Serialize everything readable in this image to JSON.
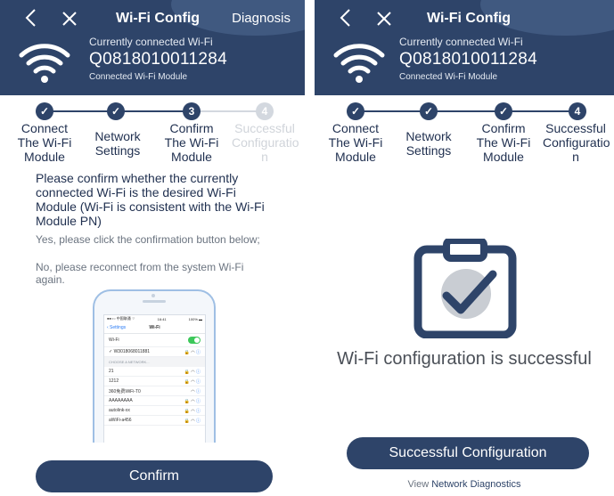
{
  "left": {
    "title": "Wi-Fi Config",
    "diagnosis": "Diagnosis",
    "current_label": "Currently connected Wi-Fi",
    "ssid": "Q0818010011284",
    "module_label": "Connected Wi-Fi Module",
    "steps": [
      {
        "num": "✓",
        "label": "Connect The Wi-Fi Module",
        "state": "done"
      },
      {
        "num": "✓",
        "label": "Network Settings",
        "state": "done"
      },
      {
        "num": "3",
        "label": "Confirm The Wi-Fi Module",
        "state": "current"
      },
      {
        "num": "4",
        "label": "Successful Configuratio n",
        "state": "pending"
      }
    ],
    "message": "Please confirm whether the currently connected Wi-Fi is the desired Wi-Fi Module (Wi-Fi is consistent with the Wi-Fi Module PN)",
    "yes_text": "Yes, please click the confirmation button below;",
    "no_text": "No, please reconnect from the system Wi-Fi again.",
    "phone": {
      "status_left": "●●○○ 中国联通 ⌔",
      "status_time": "16:41",
      "status_right": "100% ▬",
      "back": "‹ Settings",
      "screen_title": "Wi-Fi",
      "wifi_label": "Wi-Fi",
      "connected_ssid": "✓ W3018068011881",
      "section": "CHOOSE A NETWORK...",
      "networks": [
        "21",
        "1212",
        "360免费WiFi-T0",
        "AAAAAAAA",
        "autolink-xx",
        "aWiFi-a456"
      ]
    },
    "confirm": "Confirm"
  },
  "right": {
    "title": "Wi-Fi Config",
    "current_label": "Currently connected Wi-Fi",
    "ssid": "Q0818010011284",
    "module_label": "Connected Wi-Fi Module",
    "steps": [
      {
        "num": "✓",
        "label": "Connect The Wi-Fi Module",
        "state": "done"
      },
      {
        "num": "✓",
        "label": "Network Settings",
        "state": "done"
      },
      {
        "num": "✓",
        "label": "Confirm The Wi-Fi Module",
        "state": "done"
      },
      {
        "num": "4",
        "label": "Successful Configuratio n",
        "state": "current"
      }
    ],
    "success_text": "Wi-Fi configuration is successful",
    "button": "Successful Configuration",
    "view_prefix": "View",
    "view_link": "Network Diagnostics"
  },
  "colors": {
    "primary": "#2e4469",
    "dim": "#d3d8df",
    "toggle": "#3cc85a"
  }
}
